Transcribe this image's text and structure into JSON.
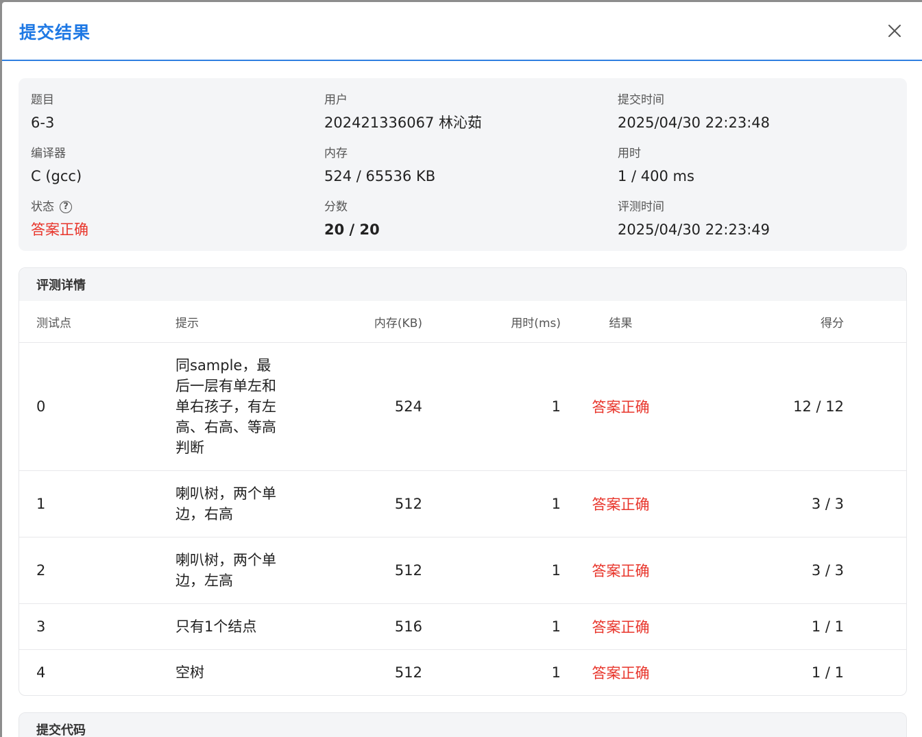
{
  "dialog": {
    "title": "提交结果",
    "close_icon": "close-icon"
  },
  "info": {
    "problem_label": "题目",
    "problem_value": "6-3",
    "user_label": "用户",
    "user_value": "202421336067 林沁茹",
    "submit_time_label": "提交时间",
    "submit_time_value": "2025/04/30 22:23:48",
    "compiler_label": "编译器",
    "compiler_value": "C (gcc)",
    "memory_label": "内存",
    "memory_value": "524 / 65536 KB",
    "time_label": "用时",
    "time_value": "1 / 400 ms",
    "status_label": "状态",
    "status_help": "?",
    "status_value": "答案正确",
    "score_label": "分数",
    "score_value": "20 / 20",
    "judge_time_label": "评测时间",
    "judge_time_value": "2025/04/30 22:23:49"
  },
  "details": {
    "title": "评测详情",
    "columns": {
      "case": "测试点",
      "hint": "提示",
      "memory": "内存(KB)",
      "time": "用时(ms)",
      "result": "结果",
      "score": "得分"
    },
    "rows": [
      {
        "case": "0",
        "hint": "同sample，最后一层有单左和单右孩子，有左高、右高、等高判断",
        "memory": "524",
        "time": "1",
        "result": "答案正确",
        "score": "12 / 12"
      },
      {
        "case": "1",
        "hint": "喇叭树，两个单边，右高",
        "memory": "512",
        "time": "1",
        "result": "答案正确",
        "score": "3 / 3"
      },
      {
        "case": "2",
        "hint": "喇叭树，两个单边，左高",
        "memory": "512",
        "time": "1",
        "result": "答案正确",
        "score": "3 / 3"
      },
      {
        "case": "3",
        "hint": "只有1个结点",
        "memory": "516",
        "time": "1",
        "result": "答案正确",
        "score": "1 / 1"
      },
      {
        "case": "4",
        "hint": "空树",
        "memory": "512",
        "time": "1",
        "result": "答案正确",
        "score": "1 / 1"
      }
    ]
  },
  "code": {
    "title": "提交代码"
  },
  "colors": {
    "accent": "#1e78e4",
    "success": "#e8352b",
    "card_bg": "#f4f5f7"
  }
}
